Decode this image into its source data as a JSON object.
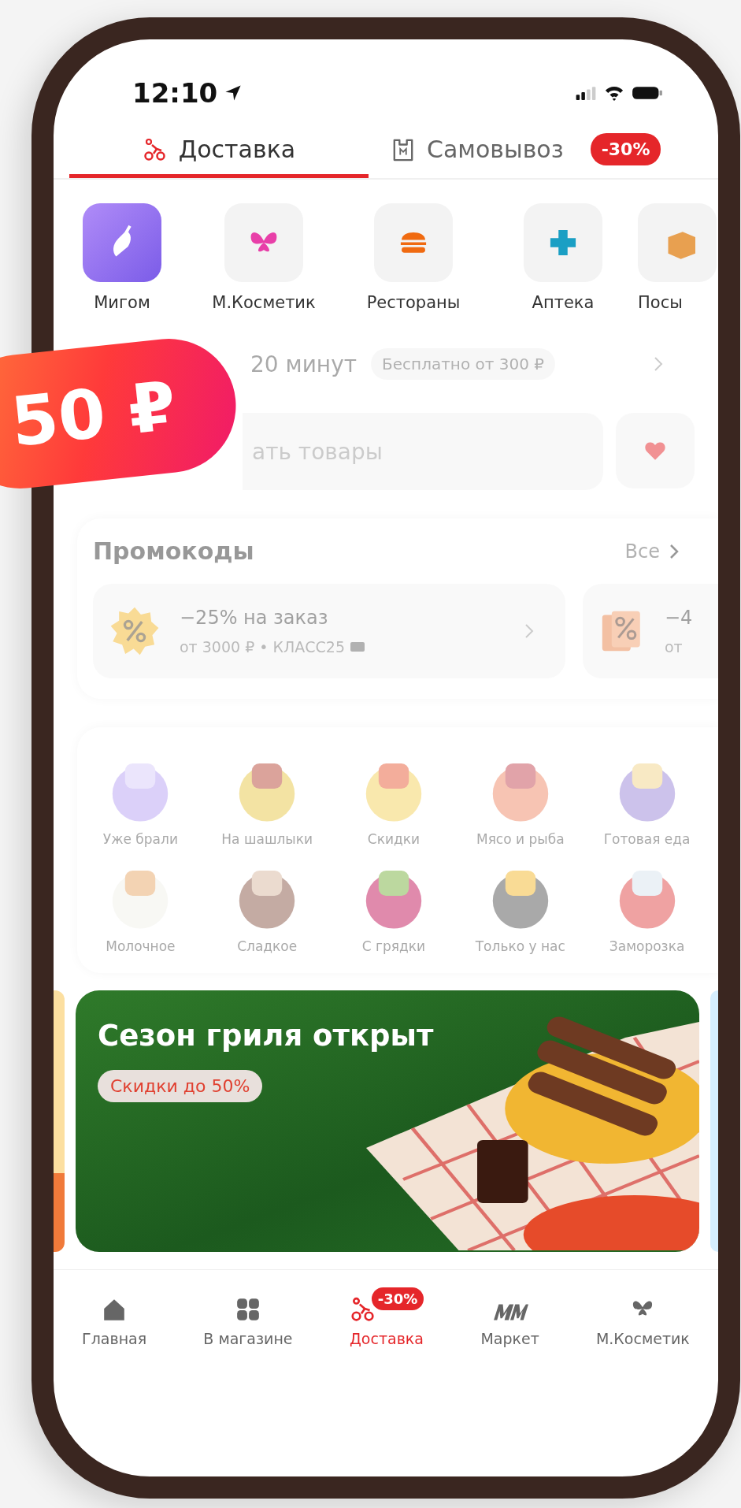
{
  "status_bar": {
    "time": "12:10"
  },
  "tabs": [
    {
      "label": "Доставка",
      "selected": true
    },
    {
      "label": "Самовывоз",
      "selected": false,
      "badge": "-30%"
    }
  ],
  "services": [
    {
      "label": "Мигом"
    },
    {
      "label": "М.Косметик"
    },
    {
      "label": "Рестораны"
    },
    {
      "label": "Аптека"
    },
    {
      "label": "Посы"
    }
  ],
  "delivery": {
    "time": "20 минут",
    "note": "Бесплатно от 300 ₽"
  },
  "search": {
    "placeholder": "ать товары"
  },
  "price_sticker": {
    "text": "50 ₽"
  },
  "promocodes": {
    "title": "Промокоды",
    "all": "Все",
    "items": [
      {
        "title": "−25% на заказ",
        "subtitle": "от 3000 ₽ • КЛАСС25"
      },
      {
        "title": "−4",
        "subtitle": "от"
      }
    ]
  },
  "categories": [
    {
      "label": "Уже брали"
    },
    {
      "label": "На шашлыки"
    },
    {
      "label": "Скидки"
    },
    {
      "label": "Мясо и рыба"
    },
    {
      "label": "Готовая еда"
    },
    {
      "label": "Молочное"
    },
    {
      "label": "Сладкое"
    },
    {
      "label": "С грядки"
    },
    {
      "label": "Только у нас"
    },
    {
      "label": "Заморозка"
    }
  ],
  "banner": {
    "title": "Сезон гриля открыт",
    "tag": "Скидки до 50%"
  },
  "nav": [
    {
      "label": "Главная",
      "selected": false
    },
    {
      "label": "В магазине",
      "selected": false
    },
    {
      "label": "Доставка",
      "selected": true,
      "badge": "-30%"
    },
    {
      "label": "Маркет",
      "selected": false
    },
    {
      "label": "М.Косметик",
      "selected": false
    }
  ]
}
